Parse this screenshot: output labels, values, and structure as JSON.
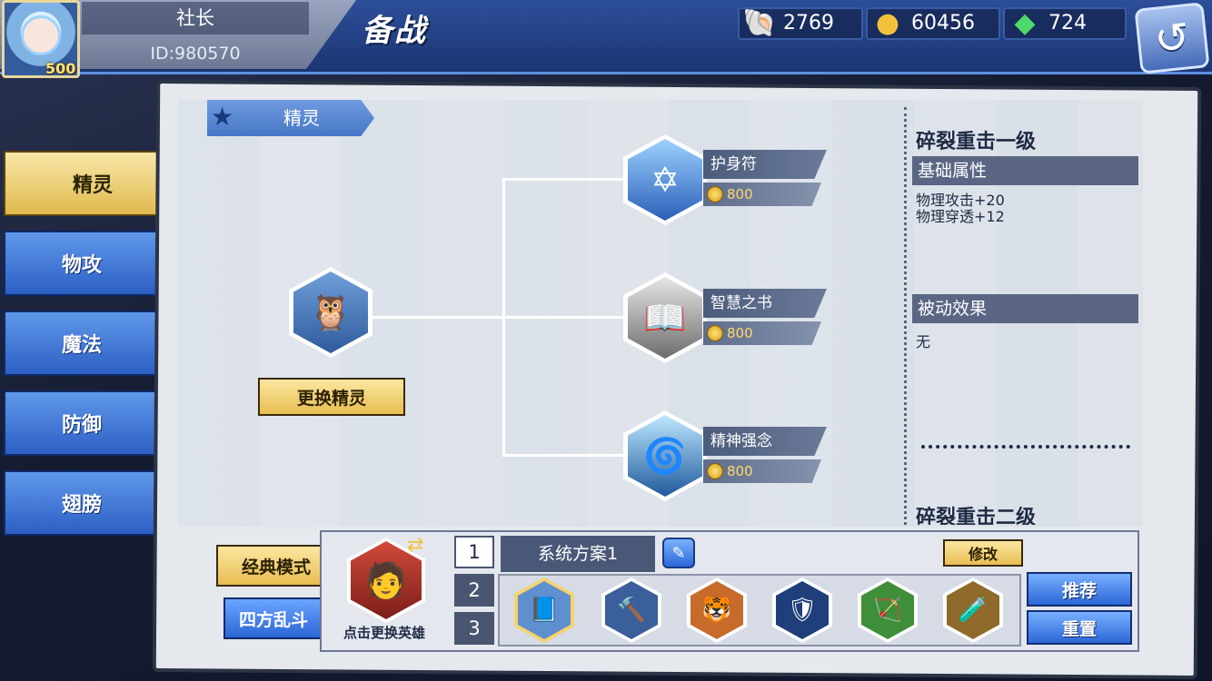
{
  "profile": {
    "name": "社长",
    "id": "ID:980570",
    "level": "500"
  },
  "header": {
    "title": "备战"
  },
  "currencies": [
    {
      "icon": "shell-icon",
      "value": "2769"
    },
    {
      "icon": "gold-coin-icon",
      "value": "60456"
    },
    {
      "icon": "green-gem-plus-icon",
      "value": "724"
    }
  ],
  "sidebar": {
    "items": [
      {
        "label": "精灵",
        "active": true
      },
      {
        "label": "物攻",
        "active": false
      },
      {
        "label": "魔法",
        "active": false
      },
      {
        "label": "防御",
        "active": false
      },
      {
        "label": "翅膀",
        "active": false
      }
    ]
  },
  "category": {
    "label": "精灵"
  },
  "tree": {
    "change_button": "更换精灵",
    "nodes": [
      {
        "name": "护身符",
        "price": "800"
      },
      {
        "name": "智慧之书",
        "price": "800"
      },
      {
        "name": "精神强念",
        "price": "800"
      }
    ]
  },
  "info": {
    "title": "碎裂重击一级",
    "base_header": "基础属性",
    "stats": [
      "物理攻击+20",
      "物理穿透+12"
    ],
    "passive_header": "被动效果",
    "passive_text": "无",
    "next_title": "碎裂重击二级"
  },
  "modes": {
    "classic": "经典模式",
    "brawl": "四方乱斗"
  },
  "hero": {
    "caption": "点击更换英雄"
  },
  "plans": {
    "numbers": [
      "1",
      "2",
      "3"
    ],
    "active": 0,
    "name": "系统方案1",
    "modify": "修改"
  },
  "equipment": [
    "book-shield-icon",
    "hammer-icon",
    "beast-claw-icon",
    "dark-knight-icon",
    "green-bow-icon",
    "potion-bag-icon"
  ],
  "actions": {
    "recommend": "推荐",
    "reset": "重置"
  }
}
